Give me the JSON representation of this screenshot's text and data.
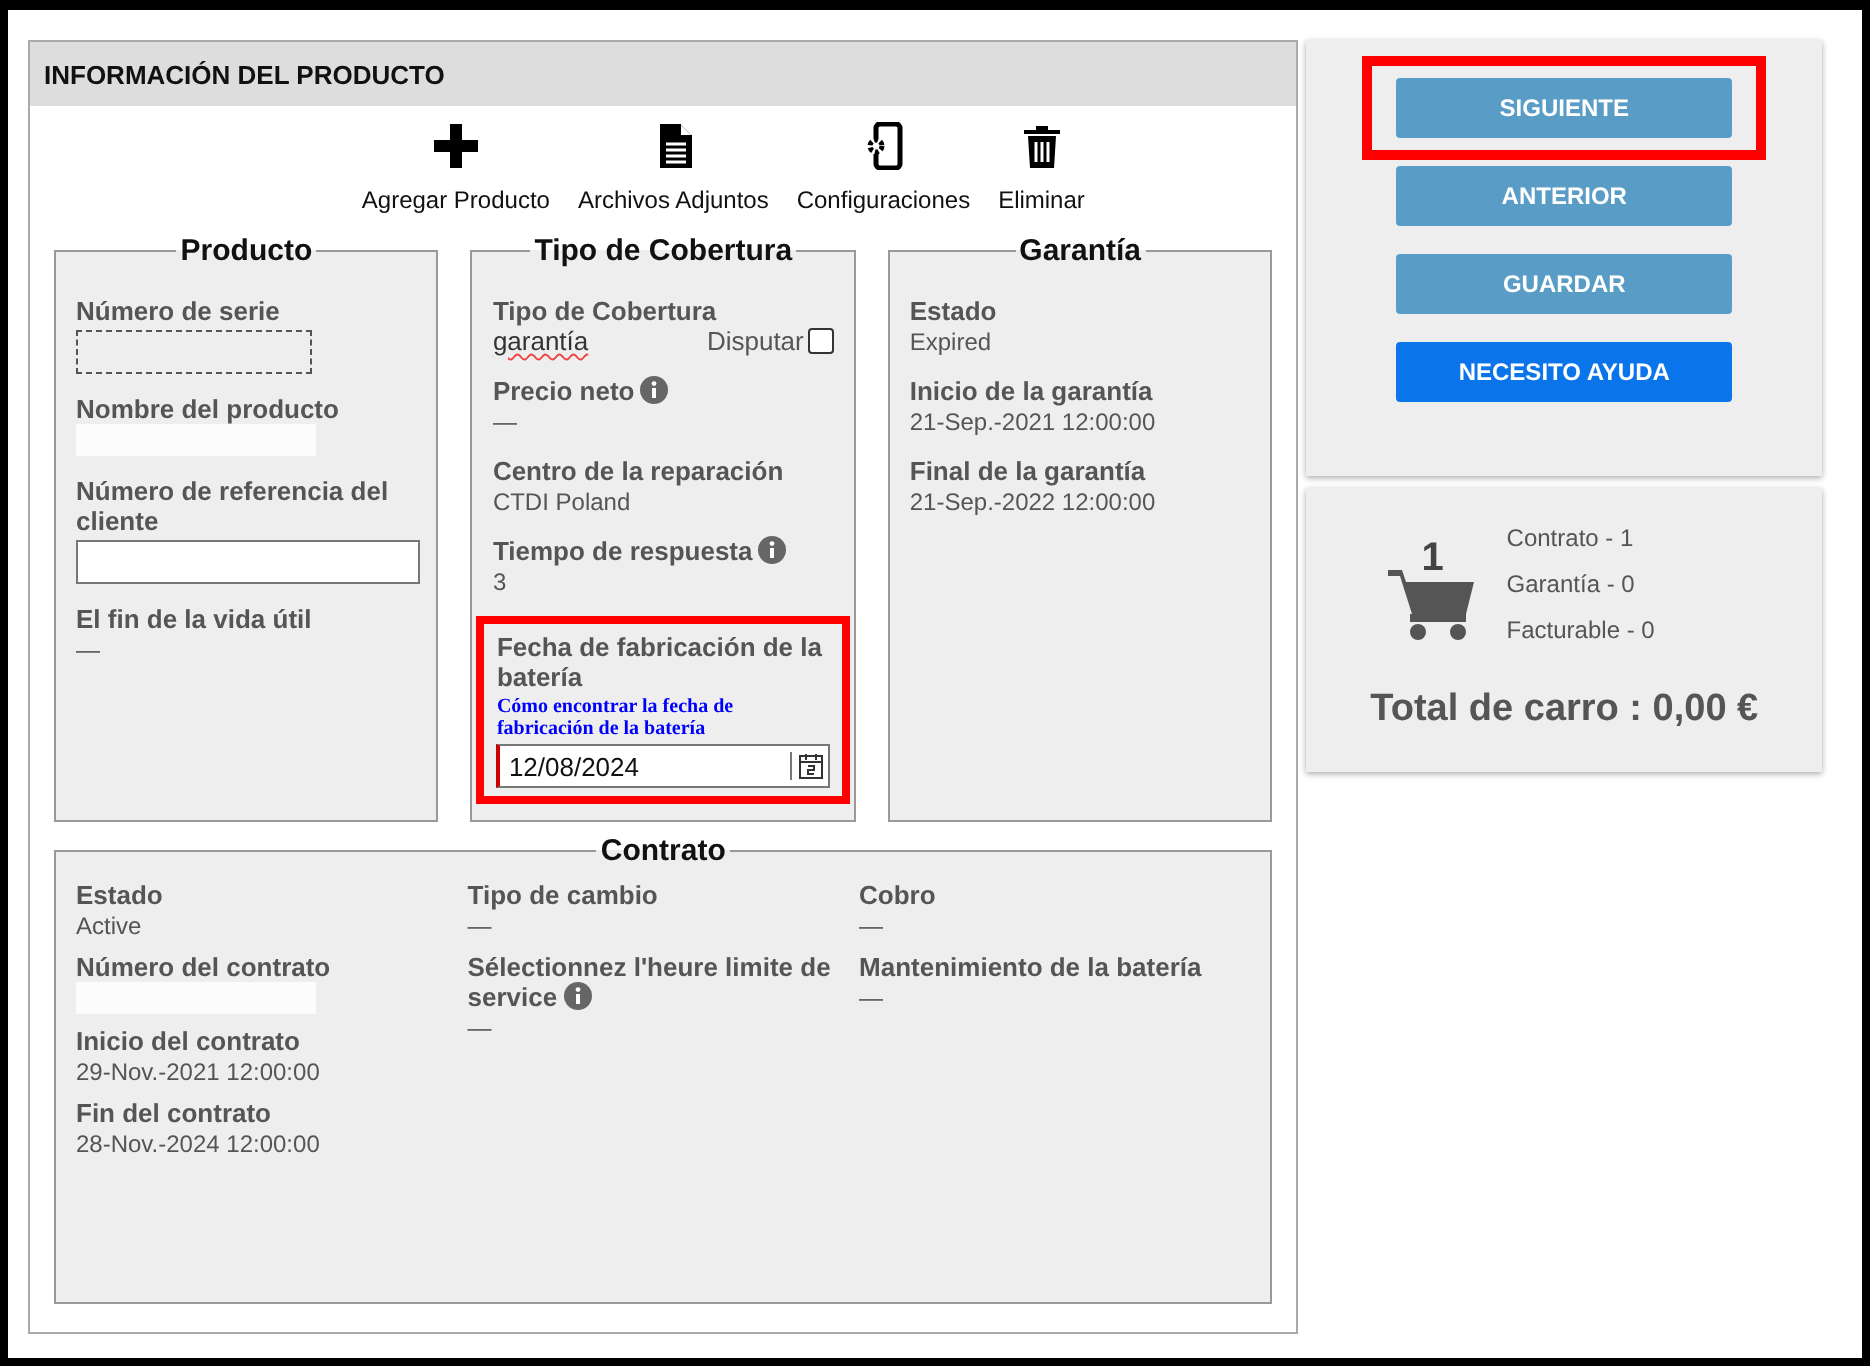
{
  "panel": {
    "title": "INFORMACIÓN DEL PRODUCTO"
  },
  "toolbar": [
    {
      "label": "Agregar Producto",
      "kind": "add"
    },
    {
      "label": "Archivos Adjuntos",
      "kind": "file"
    },
    {
      "label": "Configuraciones",
      "kind": "device"
    },
    {
      "label": "Eliminar",
      "kind": "delete"
    }
  ],
  "sections": [
    {
      "legend": "Producto",
      "fields": [
        {
          "label": "Número de serie",
          "kind": "focus-box"
        },
        {
          "label": "Nombre del producto",
          "kind": "blank"
        },
        {
          "label": "Número de referencia del cliente",
          "kind": "input"
        },
        {
          "label": "El fin de la vida útil",
          "kind": "text",
          "value": "—"
        }
      ]
    },
    {
      "legend": "Tipo de Cobertura",
      "fields": [
        {
          "label": "Tipo de Cobertura",
          "kind": "select",
          "value": "garantía",
          "checkbox": {
            "label": "Disputar",
            "checked": false
          }
        },
        {
          "label": "Precio neto",
          "kind": "text",
          "value": "—",
          "info": true
        },
        {
          "label": "Centro de la reparación",
          "kind": "text",
          "value": "CTDI Poland"
        },
        {
          "label": "Tiempo de respuesta",
          "kind": "text",
          "value": "3",
          "info": true
        },
        {
          "label": "Fecha de fabricación de la batería",
          "kind": "date",
          "link": "Cómo encontrar la fecha de fabricación de la batería",
          "value": "12/08/2024",
          "highlighted": true
        }
      ]
    },
    {
      "legend": "Garantía",
      "fields": [
        {
          "label": "Estado",
          "kind": "text",
          "value": "Expired"
        },
        {
          "label": "Inicio de la garantía",
          "kind": "text",
          "value": "21-Sep.-2021 12:00:00"
        },
        {
          "label": "Final de la garantía",
          "kind": "text",
          "value": "21-Sep.-2022 12:00:00"
        }
      ]
    }
  ],
  "contract": {
    "legend": "Contrato",
    "columns": [
      [
        {
          "label": "Estado",
          "kind": "text",
          "value": "Active"
        },
        {
          "label": "Número del contrato",
          "kind": "blank"
        },
        {
          "label": "Inicio del contrato",
          "kind": "text",
          "value": "29-Nov.-2021 12:00:00"
        },
        {
          "label": "Fin del contrato",
          "kind": "text",
          "value": "28-Nov.-2024 12:00:00"
        }
      ],
      [
        {
          "label": "Tipo de cambio",
          "kind": "text",
          "value": "—"
        },
        {
          "label": "Sélectionnez l'heure limite de service",
          "kind": "text",
          "value": "—",
          "info": true
        }
      ],
      [
        {
          "label": "Cobro",
          "kind": "text",
          "value": "—"
        },
        {
          "label": "Mantenimiento de la batería",
          "kind": "text",
          "value": "—"
        }
      ]
    ]
  },
  "actions": [
    {
      "label": "SIGUIENTE",
      "kind": "nav",
      "highlighted": true
    },
    {
      "label": "ANTERIOR",
      "kind": "nav",
      "highlighted": false
    },
    {
      "label": "GUARDAR",
      "kind": "nav",
      "highlighted": false
    },
    {
      "label": "NECESITO AYUDA",
      "kind": "help",
      "highlighted": false
    }
  ],
  "cart": {
    "count": "1",
    "lines": [
      "Contrato - 1",
      "Garantía - 0",
      "Facturable - 0"
    ],
    "total": "Total de carro : 0,00 €"
  }
}
